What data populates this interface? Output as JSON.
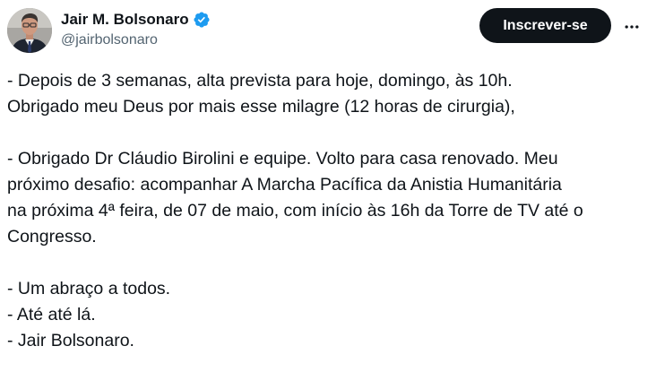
{
  "author": {
    "display_name": "Jair M. Bolsonaro",
    "handle": "@jairbolsonaro",
    "verified": true,
    "avatar_icon": "profile-photo"
  },
  "actions": {
    "subscribe_label": "Inscrever-se",
    "more_icon": "more-options-icon"
  },
  "colors": {
    "verified_badge": "#1d9bf0",
    "button_bg": "#0f1419",
    "handle_gray": "#536471"
  },
  "tweet": {
    "text": "- Depois de 3 semanas, alta prevista para hoje, domingo, às 10h.\nObrigado meu Deus por mais esse milagre (12 horas de cirurgia),\n\n- Obrigado Dr Cláudio Birolini e equipe. Volto para casa renovado. Meu\npróximo desafio: acompanhar A Marcha Pacífica da Anistia Humanitária\nna próxima 4ª feira, de 07 de maio, com início às 16h da Torre de TV até o\nCongresso.\n\n- Um abraço a todos.\n- Até até lá.\n- Jair Bolsonaro."
  }
}
